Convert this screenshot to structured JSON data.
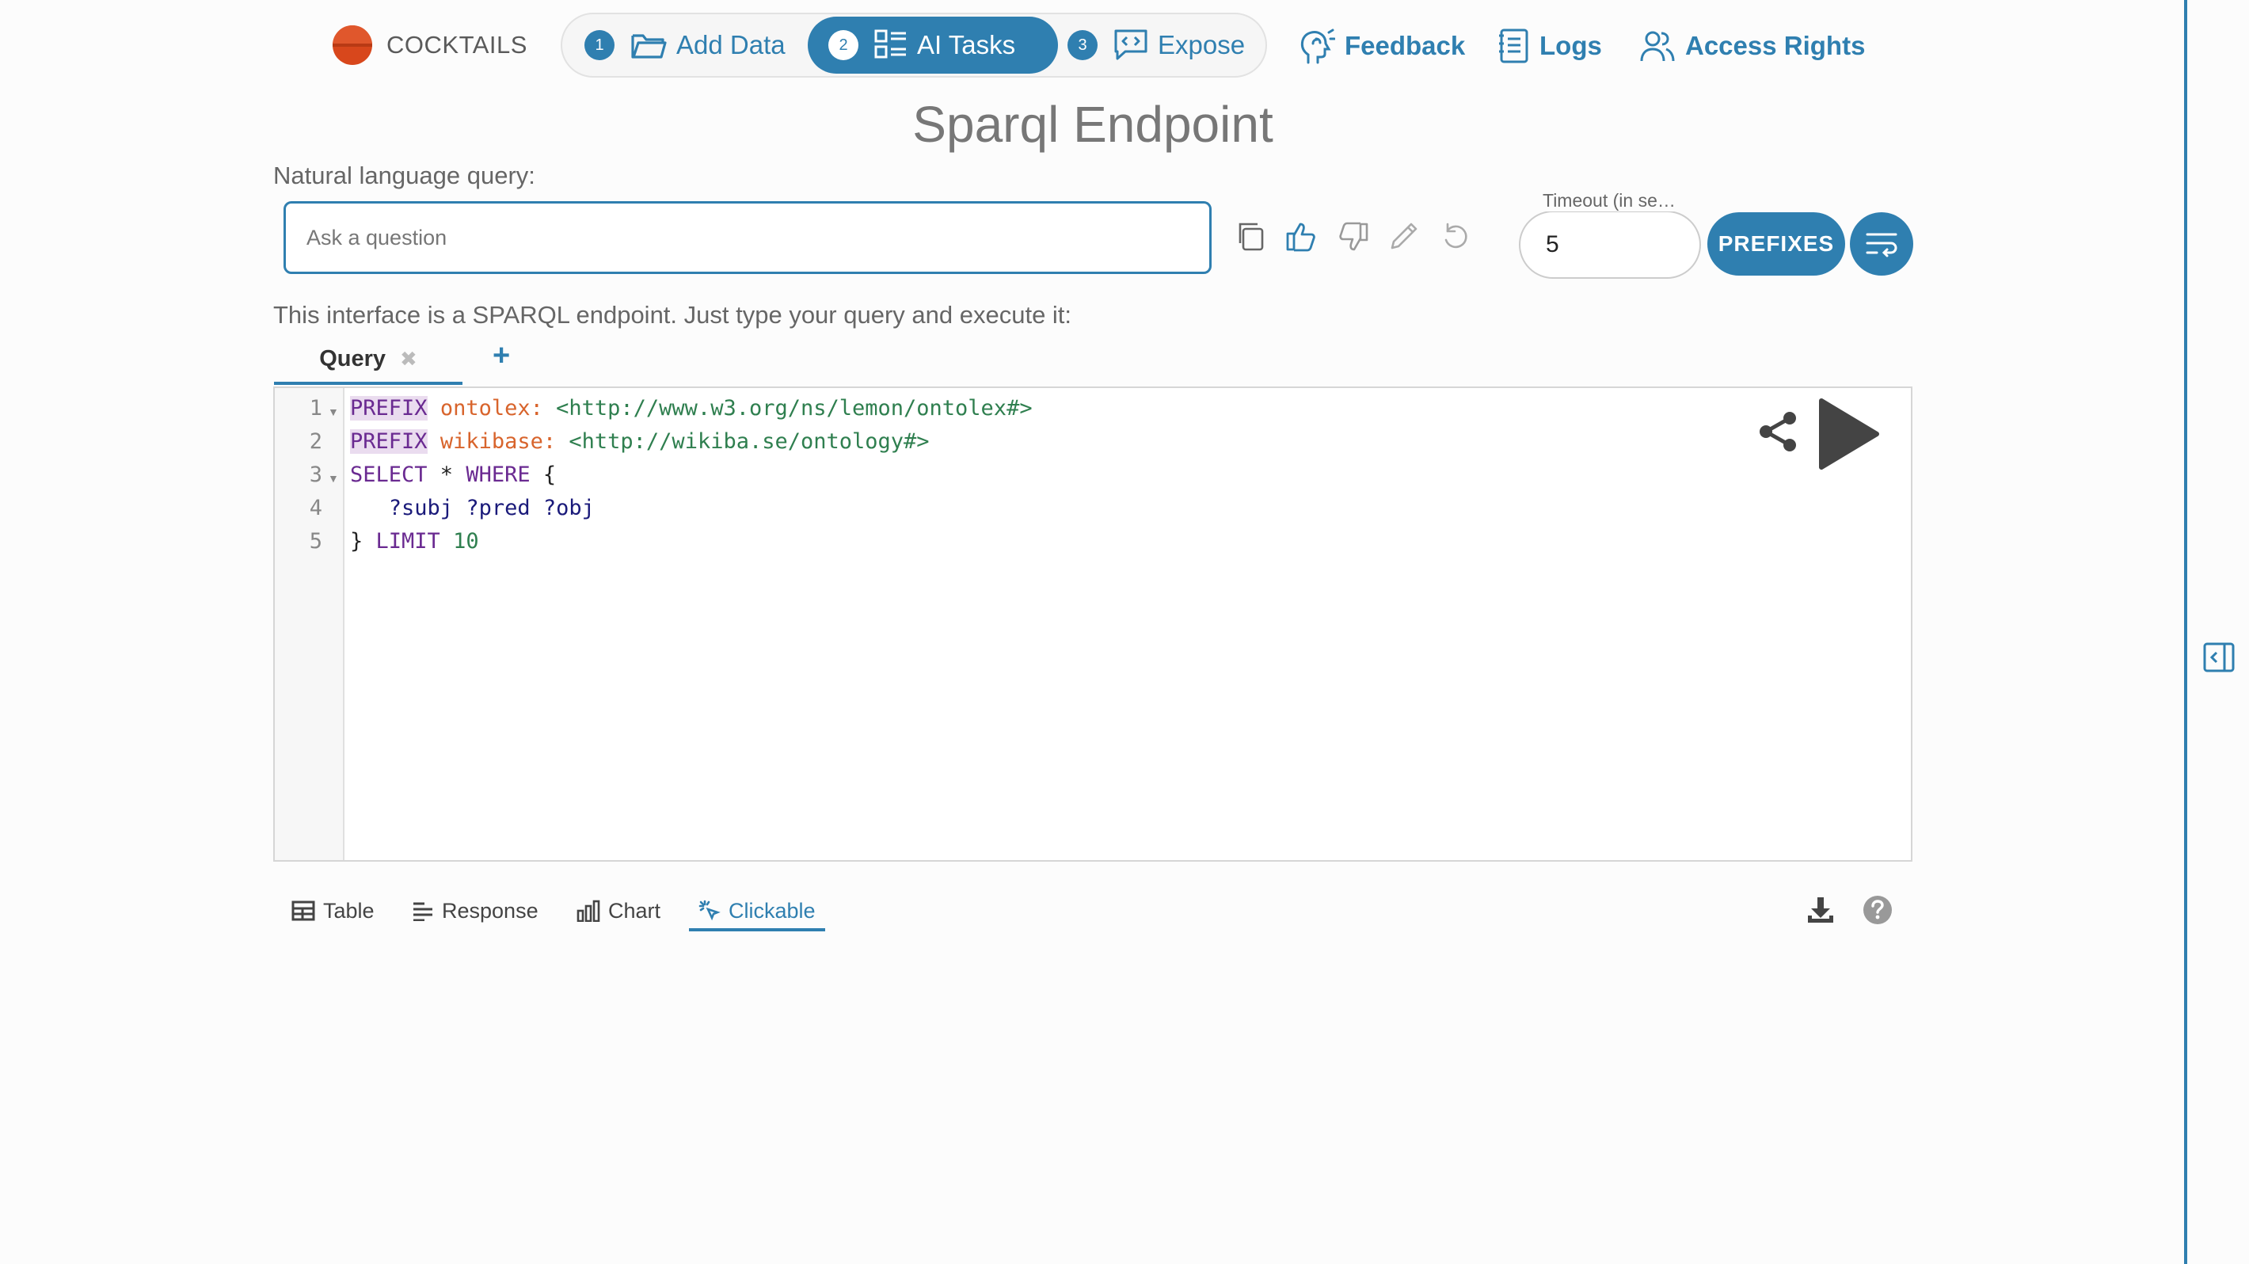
{
  "brand": {
    "name": "COCKTAILS"
  },
  "steps": [
    {
      "num": "1",
      "label": "Add Data",
      "icon": "folder-icon"
    },
    {
      "num": "2",
      "label": "AI Tasks",
      "icon": "grid-list-icon"
    },
    {
      "num": "3",
      "label": "Expose",
      "icon": "chat-code-icon"
    }
  ],
  "active_step": 2,
  "top_links": {
    "feedback": "Feedback",
    "logs": "Logs",
    "access_rights": "Access Rights"
  },
  "page_title": "Sparql Endpoint",
  "nlq": {
    "label": "Natural language query:",
    "placeholder": "Ask a question",
    "value": ""
  },
  "timeout": {
    "label": "Timeout (in se…",
    "value": "5"
  },
  "prefixes_label": "PREFIXES",
  "intro": "This interface is a SPARQL endpoint. Just type your query and execute it:",
  "query_tab": {
    "label": "Query",
    "close_glyph": "✖",
    "add_glyph": "+"
  },
  "editor": {
    "line_numbers": [
      "1",
      "2",
      "3",
      "4",
      "5"
    ],
    "lines": [
      [
        {
          "t": "PREFIX",
          "c": "kwbg"
        },
        {
          "t": " "
        },
        {
          "t": "ontolex:",
          "c": "pre"
        },
        {
          "t": " "
        },
        {
          "t": "<http://www.w3.org/ns/lemon/ontolex#>",
          "c": "iri"
        }
      ],
      [
        {
          "t": "PREFIX",
          "c": "kwbg"
        },
        {
          "t": " "
        },
        {
          "t": "wikibase:",
          "c": "pre"
        },
        {
          "t": " "
        },
        {
          "t": "<http://wikiba.se/ontology#>",
          "c": "iri"
        }
      ],
      [
        {
          "t": "SELECT",
          "c": "kw"
        },
        {
          "t": " * "
        },
        {
          "t": "WHERE",
          "c": "kw"
        },
        {
          "t": " {"
        }
      ],
      [
        {
          "t": "   "
        },
        {
          "t": "?subj",
          "c": "var"
        },
        {
          "t": " "
        },
        {
          "t": "?pred",
          "c": "var"
        },
        {
          "t": " "
        },
        {
          "t": "?obj",
          "c": "var"
        }
      ],
      [
        {
          "t": "} "
        },
        {
          "t": "LIMIT",
          "c": "kw"
        },
        {
          "t": " "
        },
        {
          "t": "10",
          "c": "num"
        }
      ]
    ]
  },
  "result_tabs": [
    {
      "label": "Table",
      "icon": "table-icon"
    },
    {
      "label": "Response",
      "icon": "align-left-icon"
    },
    {
      "label": "Chart",
      "icon": "bar-chart-icon"
    },
    {
      "label": "Clickable",
      "icon": "click-icon"
    }
  ],
  "active_result_tab": "Clickable",
  "colors": {
    "accent": "#2f7fb0",
    "brand": "#d8471c"
  }
}
